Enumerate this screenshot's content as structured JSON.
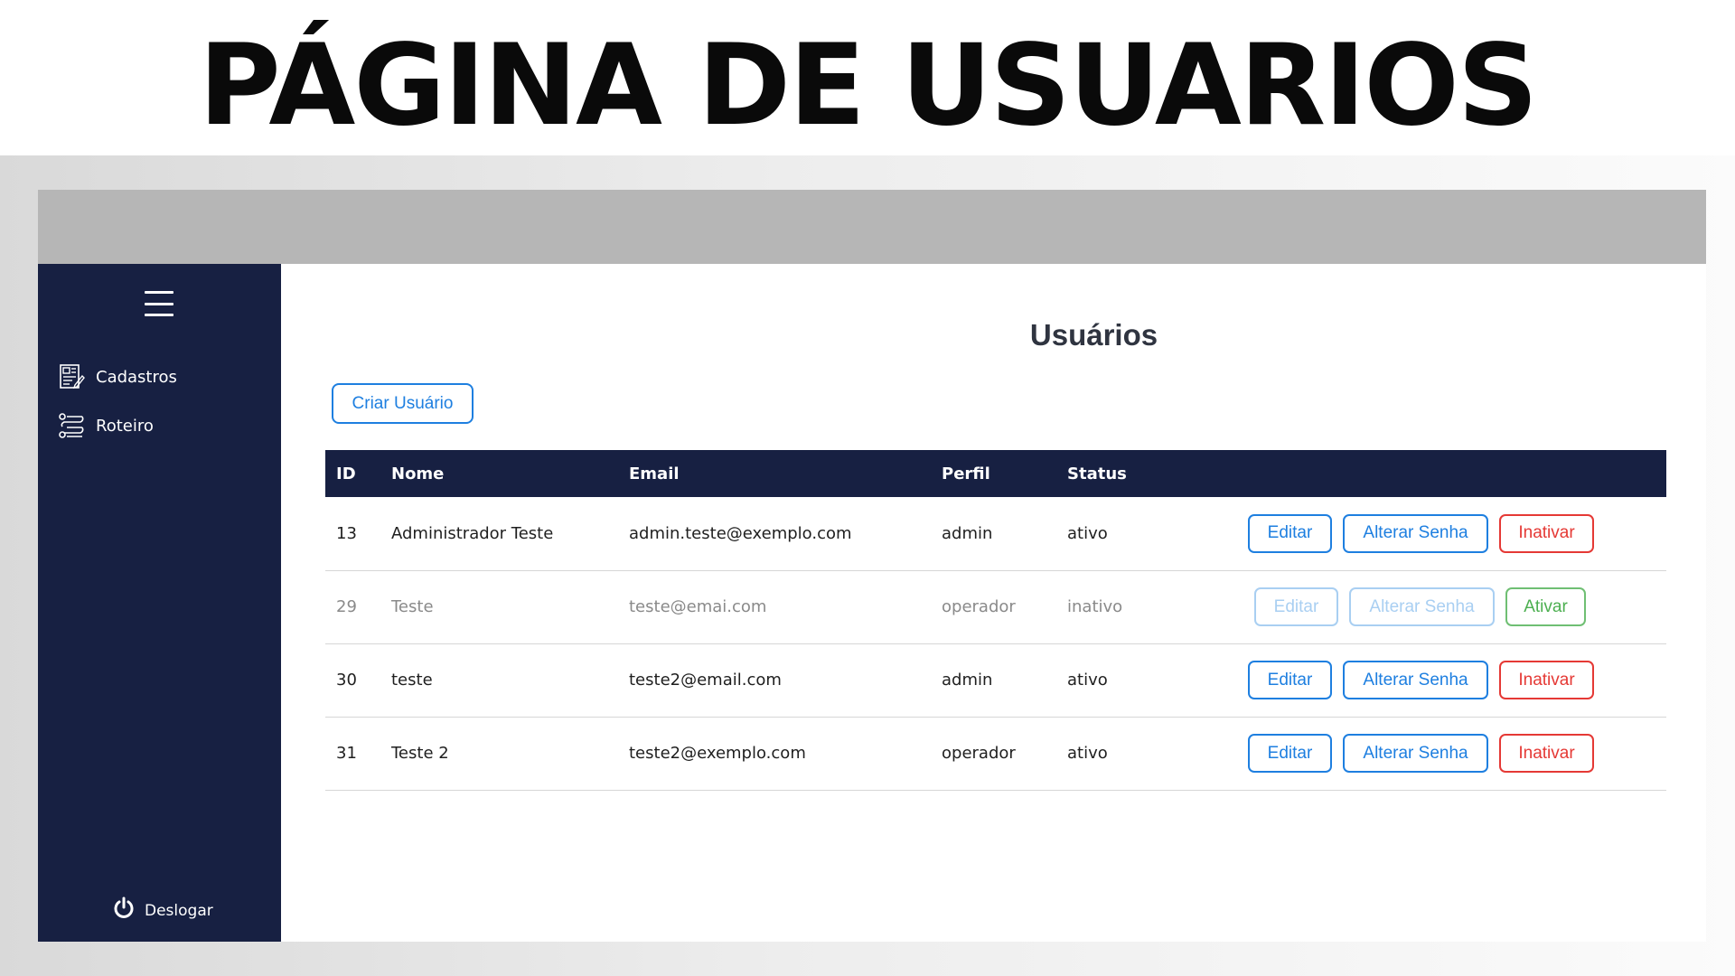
{
  "banner": {
    "title": "PÁGINA DE USUARIOS"
  },
  "sidebar": {
    "items": [
      {
        "label": "Cadastros",
        "icon": "form-icon"
      },
      {
        "label": "Roteiro",
        "icon": "route-icon"
      }
    ],
    "logout_label": "Deslogar"
  },
  "main": {
    "title": "Usuários",
    "create_button": "Criar Usuário",
    "table": {
      "headers": [
        "ID",
        "Nome",
        "Email",
        "Perfil",
        "Status"
      ],
      "rows": [
        {
          "id": "13",
          "nome": "Administrador Teste",
          "email": "admin.teste@exemplo.com",
          "perfil": "admin",
          "status": "ativo",
          "toggle_label": "Inativar"
        },
        {
          "id": "29",
          "nome": "Teste",
          "email": "teste@emai.com",
          "perfil": "operador",
          "status": "inativo",
          "toggle_label": "Ativar"
        },
        {
          "id": "30",
          "nome": "teste",
          "email": "teste2@email.com",
          "perfil": "admin",
          "status": "ativo",
          "toggle_label": "Inativar"
        },
        {
          "id": "31",
          "nome": "Teste 2",
          "email": "teste2@exemplo.com",
          "perfil": "operador",
          "status": "ativo",
          "toggle_label": "Inativar"
        }
      ]
    },
    "actions": {
      "edit_label": "Editar",
      "change_password_label": "Alterar Senha"
    }
  },
  "colors": {
    "sidebar_bg": "#172042",
    "topbar_bg": "#b6b6b6",
    "primary": "#1e7fe0",
    "danger": "#e53935",
    "success": "#4caf50"
  }
}
